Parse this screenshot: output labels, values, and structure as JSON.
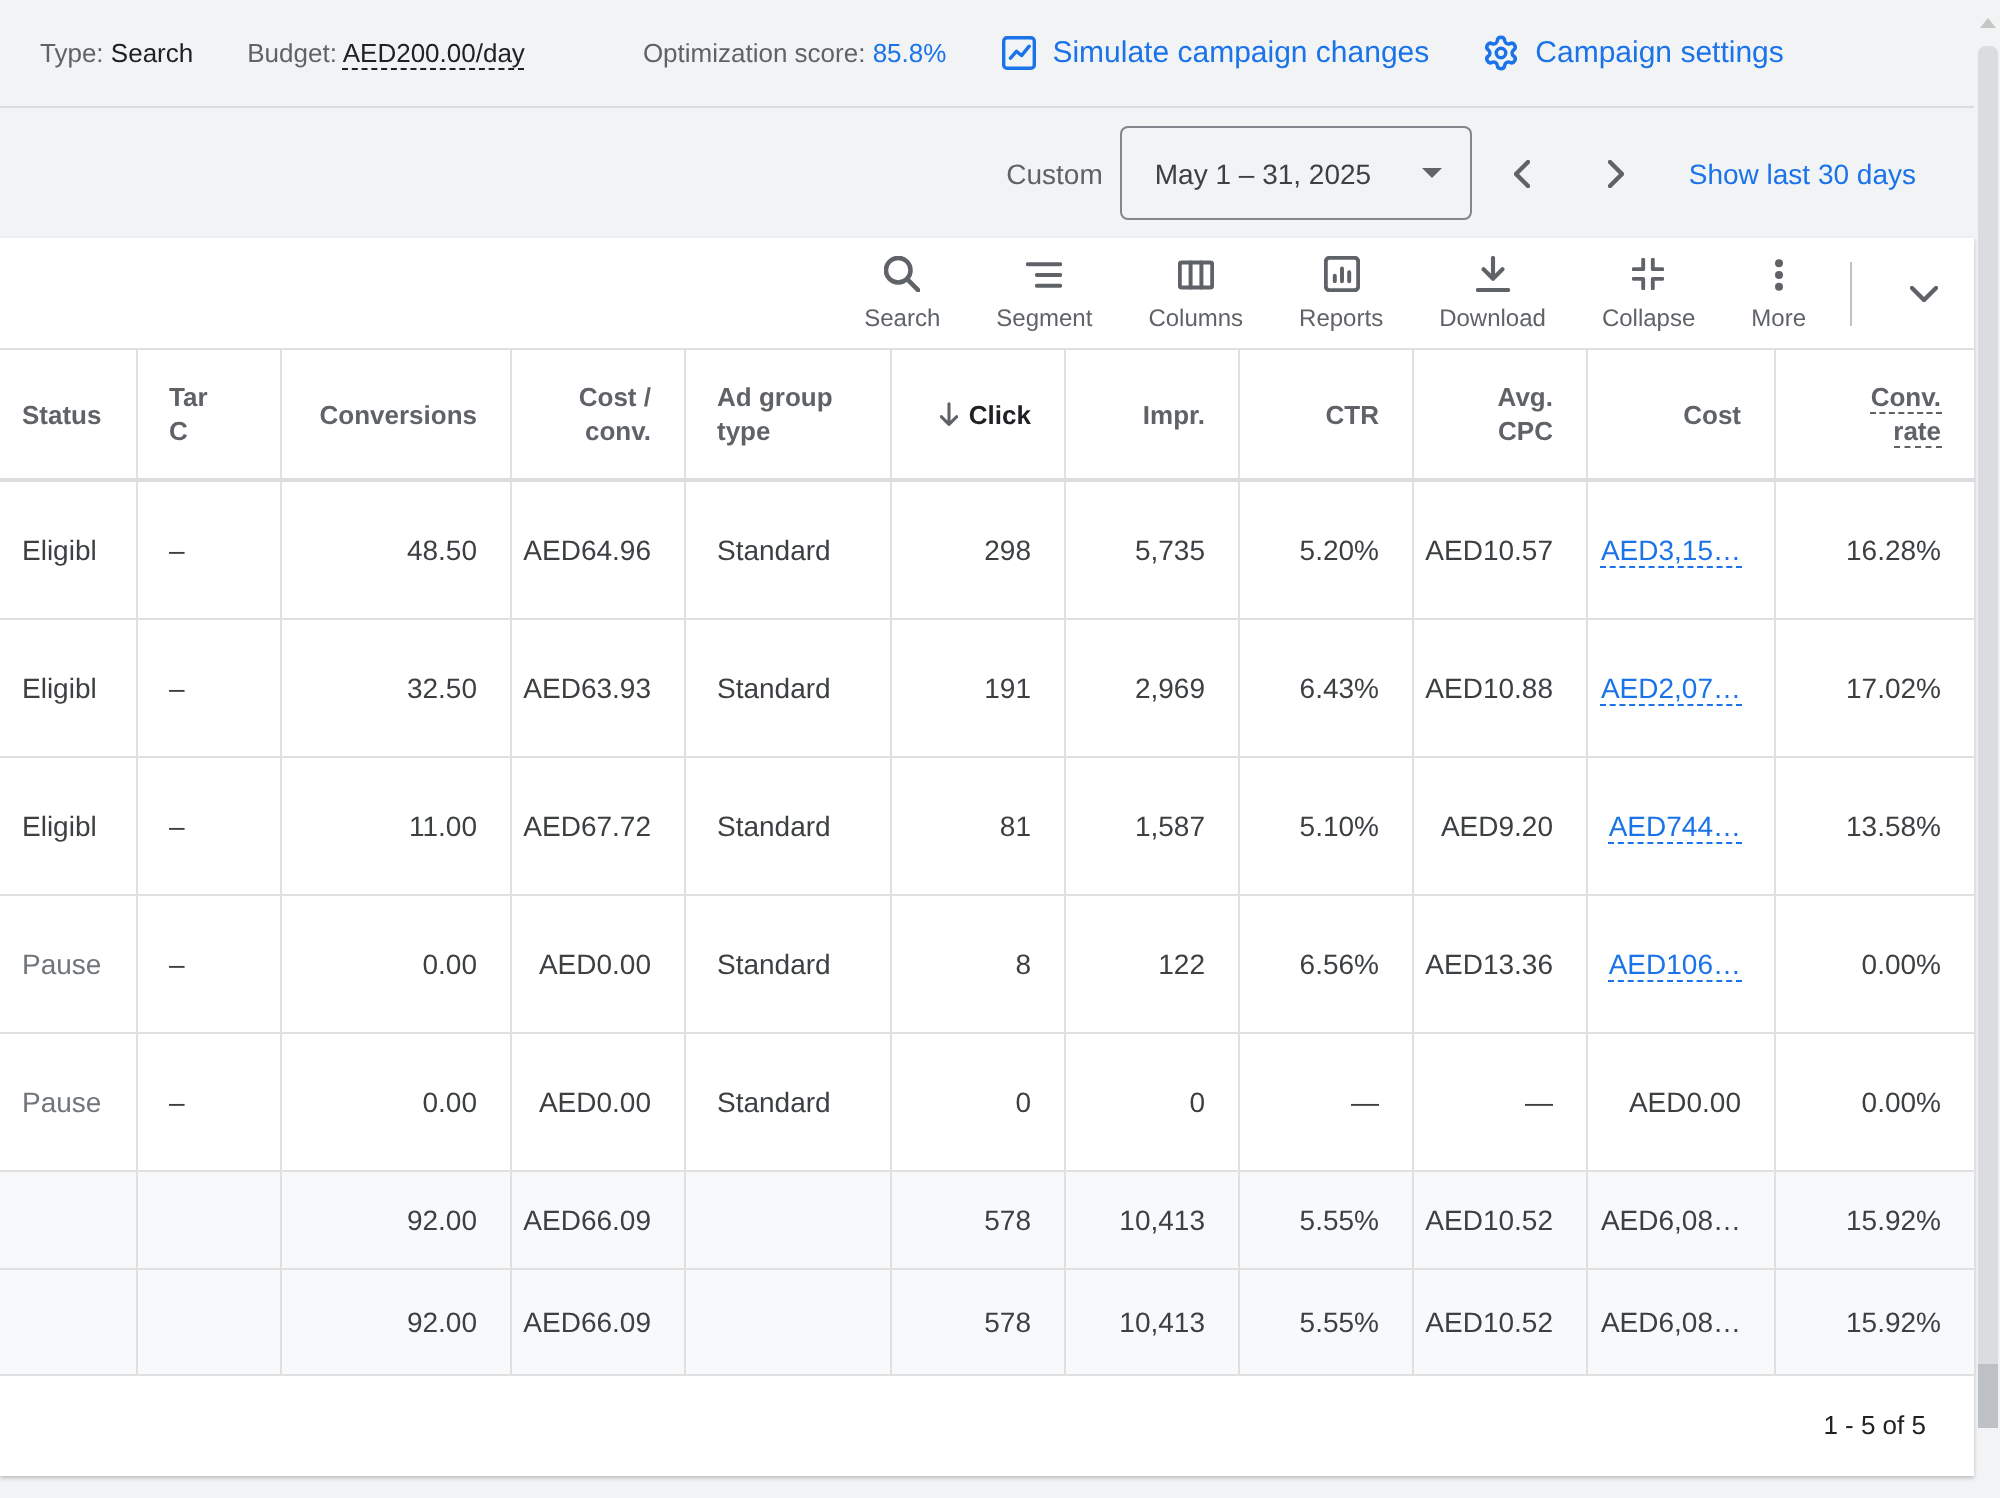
{
  "summary": {
    "type": {
      "label": "Type:",
      "value": "Search"
    },
    "budget": {
      "label": "Budget:",
      "value": "AED200.00/day"
    },
    "optimization_score": {
      "label": "Optimization score:",
      "value": "85.8%"
    },
    "links": [
      {
        "kind": "simulate",
        "label": "Simulate campaign changes"
      },
      {
        "kind": "settings",
        "label": "Campaign settings"
      }
    ]
  },
  "date_bar": {
    "range_label": "Custom",
    "date_range": "May 1 – 31, 2025",
    "shortcut_link": "Show last 30 days"
  },
  "toolbar": [
    {
      "kind": "search",
      "label": "Search"
    },
    {
      "kind": "segment",
      "label": "Segment"
    },
    {
      "kind": "columns",
      "label": "Columns"
    },
    {
      "kind": "reports",
      "label": "Reports"
    },
    {
      "kind": "download",
      "label": "Download"
    },
    {
      "kind": "collapse",
      "label": "Collapse"
    },
    {
      "kind": "more",
      "label": "More"
    }
  ],
  "table": {
    "columns": [
      {
        "kind": "text",
        "lines": [
          "Status"
        ],
        "sorted": false,
        "underlined": false
      },
      {
        "kind": "text",
        "lines": [
          "Tar",
          "C"
        ],
        "sorted": false,
        "underlined": false
      },
      {
        "kind": "number",
        "lines": [
          "Conversions"
        ],
        "sorted": false,
        "underlined": false
      },
      {
        "kind": "number",
        "lines": [
          "Cost /",
          "conv."
        ],
        "sorted": false,
        "underlined": false
      },
      {
        "kind": "text",
        "lines": [
          "Ad group",
          "type"
        ],
        "sorted": false,
        "underlined": false
      },
      {
        "kind": "number",
        "lines": [
          "Click"
        ],
        "sorted": true,
        "underlined": false
      },
      {
        "kind": "number",
        "lines": [
          "Impr."
        ],
        "sorted": false,
        "underlined": false
      },
      {
        "kind": "number",
        "lines": [
          "CTR"
        ],
        "sorted": false,
        "underlined": false
      },
      {
        "kind": "number",
        "lines": [
          "Avg.",
          "CPC"
        ],
        "sorted": false,
        "underlined": false
      },
      {
        "kind": "linked",
        "lines": [
          "Cost"
        ],
        "sorted": false,
        "underlined": false
      },
      {
        "kind": "number",
        "lines": [
          "Conv.",
          "rate"
        ],
        "sorted": false,
        "underlined": true
      }
    ],
    "rows": [
      {
        "cells": [
          "Eligibl",
          "–",
          "48.50",
          "AED64.96",
          "Standard",
          "298",
          "5,735",
          "5.20%",
          "AED10.57",
          "AED3,15…",
          "16.28%"
        ],
        "paused": false,
        "cost_linked": true
      },
      {
        "cells": [
          "Eligibl",
          "–",
          "32.50",
          "AED63.93",
          "Standard",
          "191",
          "2,969",
          "6.43%",
          "AED10.88",
          "AED2,07…",
          "17.02%"
        ],
        "paused": false,
        "cost_linked": true
      },
      {
        "cells": [
          "Eligibl",
          "–",
          "11.00",
          "AED67.72",
          "Standard",
          "81",
          "1,587",
          "5.10%",
          "AED9.20",
          "AED744…",
          "13.58%"
        ],
        "paused": false,
        "cost_linked": true
      },
      {
        "cells": [
          "Pause",
          "–",
          "0.00",
          "AED0.00",
          "Standard",
          "8",
          "122",
          "6.56%",
          "AED13.36",
          "AED106…",
          "0.00%"
        ],
        "paused": true,
        "cost_linked": true
      },
      {
        "cells": [
          "Pause",
          "–",
          "0.00",
          "AED0.00",
          "Standard",
          "0",
          "0",
          "—",
          "—",
          "AED0.00",
          "0.00%"
        ],
        "paused": true,
        "cost_linked": false
      }
    ],
    "totals": [
      {
        "cells": [
          null,
          null,
          "92.00",
          "AED66.09",
          null,
          "578",
          "10,413",
          "5.55%",
          "AED10.52",
          "AED6,08…",
          "15.92%"
        ]
      },
      {
        "cells": [
          null,
          null,
          "92.00",
          "AED66.09",
          null,
          "578",
          "10,413",
          "5.55%",
          "AED10.52",
          "AED6,08…",
          "15.92%"
        ]
      }
    ]
  },
  "pagination": "1 - 5 of 5"
}
